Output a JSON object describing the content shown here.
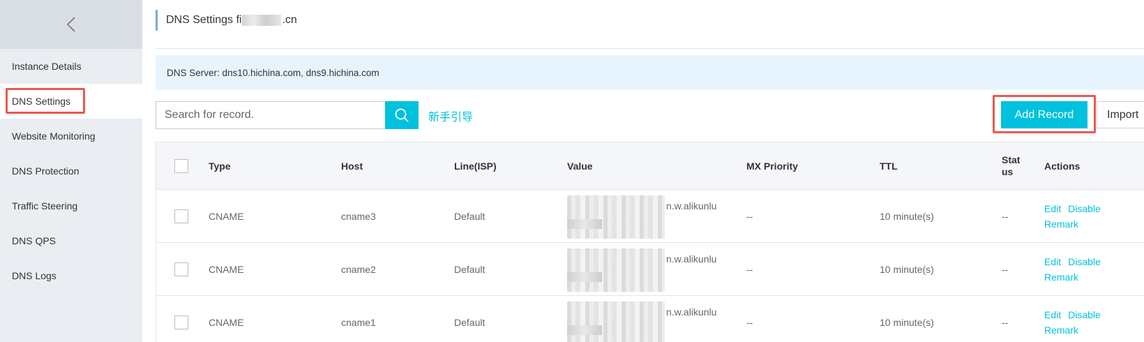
{
  "sidebar": {
    "back_icon": "chevron-left-icon",
    "items": [
      {
        "label": "Instance Details"
      },
      {
        "label": "DNS Settings"
      },
      {
        "label": "Website Monitoring"
      },
      {
        "label": "DNS Protection"
      },
      {
        "label": "Traffic Steering"
      },
      {
        "label": "DNS QPS"
      },
      {
        "label": "DNS Logs"
      }
    ],
    "active_index": 1
  },
  "header": {
    "title_prefix": "DNS Settings fi",
    "title_suffix": ".cn"
  },
  "info": {
    "text": "DNS Server: dns10.hichina.com, dns9.hichina.com"
  },
  "toolbar": {
    "search_placeholder": "Search for record.",
    "search_icon": "search-icon",
    "guide_link": "新手引导",
    "add_record_label": "Add Record",
    "import_label": "Import"
  },
  "table": {
    "headers": {
      "type": "Type",
      "host": "Host",
      "line": "Line(ISP)",
      "value": "Value",
      "mx": "MX Priority",
      "ttl": "TTL",
      "status": "Stat us",
      "actions": "Actions"
    },
    "rows": [
      {
        "type": "CNAME",
        "host": "cname3",
        "line": "Default",
        "value_visible": "n.w.alikunlu",
        "mx": "--",
        "ttl": "10 minute(s)",
        "status": "--",
        "edit": "Edit",
        "disable": "Disable",
        "remark": "Remark"
      },
      {
        "type": "CNAME",
        "host": "cname2",
        "line": "Default",
        "value_visible": "n.w.alikunlu",
        "mx": "--",
        "ttl": "10 minute(s)",
        "status": "--",
        "edit": "Edit",
        "disable": "Disable",
        "remark": "Remark"
      },
      {
        "type": "CNAME",
        "host": "cname1",
        "line": "Default",
        "value_visible": "n.w.alikunlu",
        "mx": "--",
        "ttl": "10 minute(s)",
        "status": "--",
        "edit": "Edit",
        "disable": "Disable",
        "remark": "Remark"
      }
    ]
  },
  "colors": {
    "accent": "#00c1de",
    "highlight": "#e85a4f",
    "sidebar_bg": "#eaedf1",
    "info_bg": "#e8f4fd"
  }
}
